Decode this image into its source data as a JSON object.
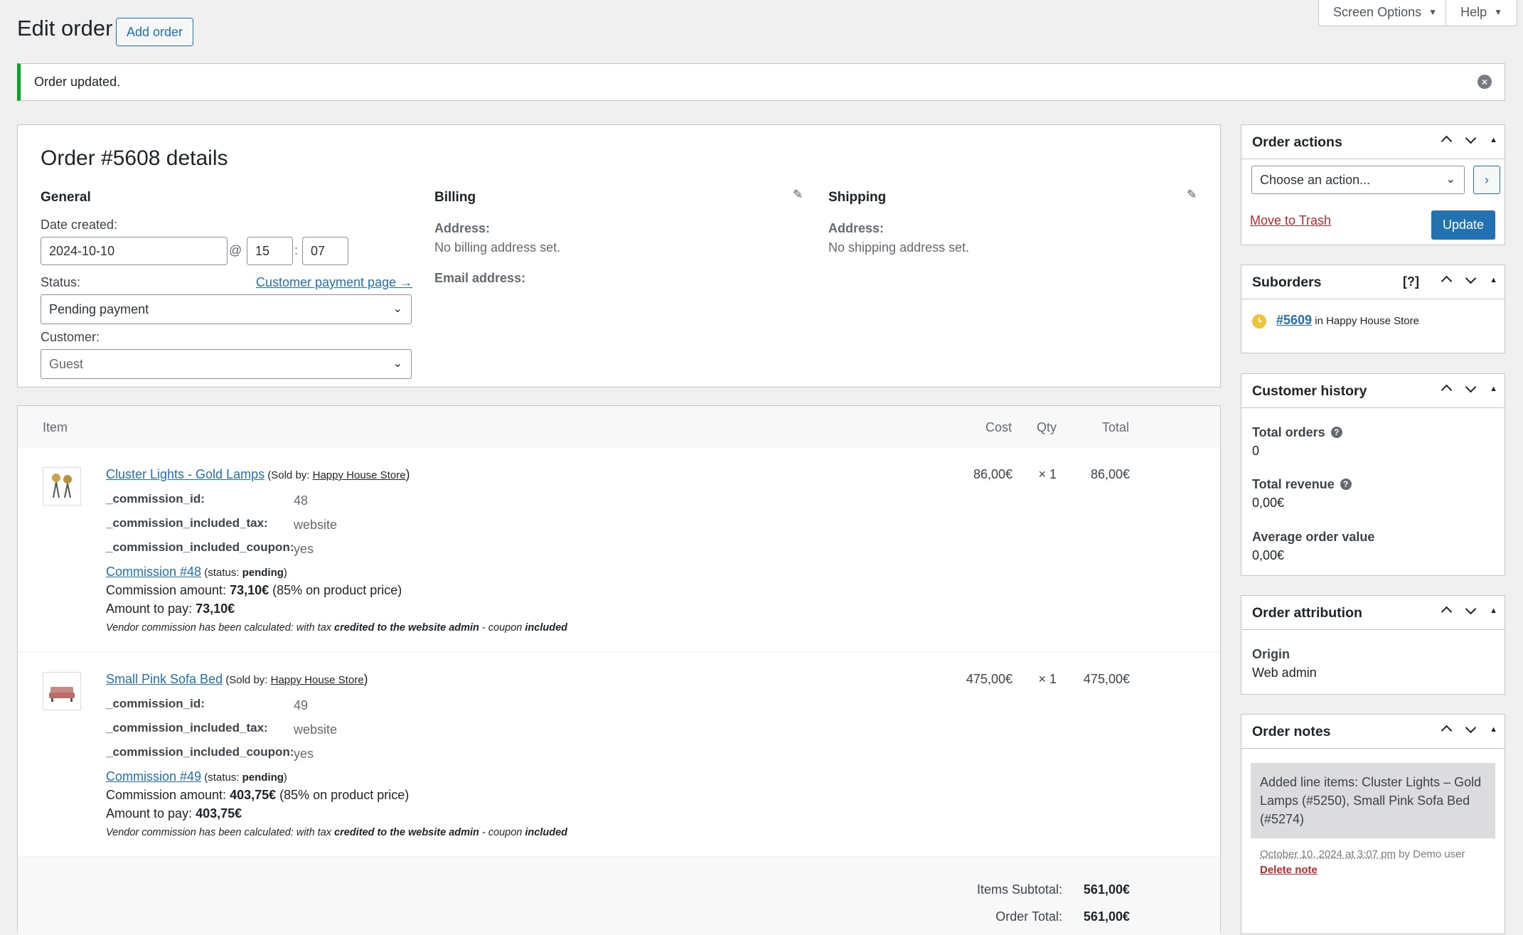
{
  "header": {
    "title": "Edit order",
    "add_order": "Add order",
    "screen_options": "Screen Options",
    "help": "Help"
  },
  "notice": {
    "text": "Order updated."
  },
  "order": {
    "heading": "Order #5608 details",
    "general": {
      "title": "General",
      "date_created_label": "Date created:",
      "date": "2024-10-10",
      "at": "@",
      "hour": "15",
      "colon": ":",
      "minute": "07",
      "status_label": "Status:",
      "customer_payment_link": "Customer payment page →",
      "status_value": "Pending payment",
      "customer_label": "Customer:",
      "customer_value": "Guest"
    },
    "billing": {
      "title": "Billing",
      "address_label": "Address:",
      "address_value": "No billing address set.",
      "email_label": "Email address:"
    },
    "shipping": {
      "title": "Shipping",
      "address_label": "Address:",
      "address_value": "No shipping address set."
    }
  },
  "items": {
    "columns": {
      "item": "Item",
      "cost": "Cost",
      "qty": "Qty",
      "total": "Total"
    },
    "rows": [
      {
        "name": "Cluster Lights - Gold Lamps",
        "sold_by_prefix": " (Sold by: ",
        "vendor": "Happy House Store",
        "sold_by_suffix": ")",
        "cost": "86,00€",
        "qty": "× 1",
        "total": "86,00€",
        "meta": [
          {
            "key": "_commission_id:",
            "value": "48"
          },
          {
            "key": "_commission_included_tax:",
            "value": "website"
          },
          {
            "key": "_commission_included_coupon:",
            "value": "yes"
          }
        ],
        "commission_link": "Commission #48",
        "status_prefix": " (status: ",
        "status": "pending",
        "status_suffix": ")",
        "amount_label": "Commission amount: ",
        "amount": "73,10€",
        "amount_note": " (85% on product price)",
        "to_pay_label": "Amount to pay: ",
        "to_pay": "73,10€"
      },
      {
        "name": "Small Pink Sofa Bed",
        "sold_by_prefix": " (Sold by: ",
        "vendor": "Happy House Store",
        "sold_by_suffix": ")",
        "cost": "475,00€",
        "qty": "× 1",
        "total": "475,00€",
        "meta": [
          {
            "key": "_commission_id:",
            "value": "49"
          },
          {
            "key": "_commission_included_tax:",
            "value": "website"
          },
          {
            "key": "_commission_included_coupon:",
            "value": "yes"
          }
        ],
        "commission_link": "Commission #49",
        "status_prefix": " (status: ",
        "status": "pending",
        "status_suffix": ")",
        "amount_label": "Commission amount: ",
        "amount": "403,75€",
        "amount_note": " (85% on product price)",
        "to_pay_label": "Amount to pay: ",
        "to_pay": "403,75€"
      }
    ],
    "calc_note": {
      "part1": "Vendor commission has been calculated: with tax ",
      "bold1": "credited to the website admin",
      "part2": " - coupon ",
      "bold2": "included"
    },
    "totals": {
      "subtotal_label": "Items Subtotal:",
      "subtotal": "561,00€",
      "order_total_label": "Order Total:",
      "order_total": "561,00€"
    }
  },
  "sidebar": {
    "order_actions": {
      "title": "Order actions",
      "select_value": "Choose an action...",
      "trash": "Move to Trash",
      "update": "Update"
    },
    "suborders": {
      "title": "Suborders",
      "help": "[?]",
      "order_link": "#5609",
      "in_text": " in Happy House Store"
    },
    "customer_history": {
      "title": "Customer history",
      "total_orders_label": "Total orders",
      "total_orders": "0",
      "total_revenue_label": "Total revenue",
      "total_revenue": "0,00€",
      "avg_label": "Average order value",
      "avg": "0,00€"
    },
    "order_attribution": {
      "title": "Order attribution",
      "origin_label": "Origin",
      "origin": "Web admin"
    },
    "order_notes": {
      "title": "Order notes",
      "note": "Added line items: Cluster Lights – Gold Lamps (#5250), Small Pink Sofa Bed (#5274)",
      "date": "October 10, 2024 at 3:07 pm",
      "by": " by Demo user",
      "delete": "Delete note"
    }
  }
}
